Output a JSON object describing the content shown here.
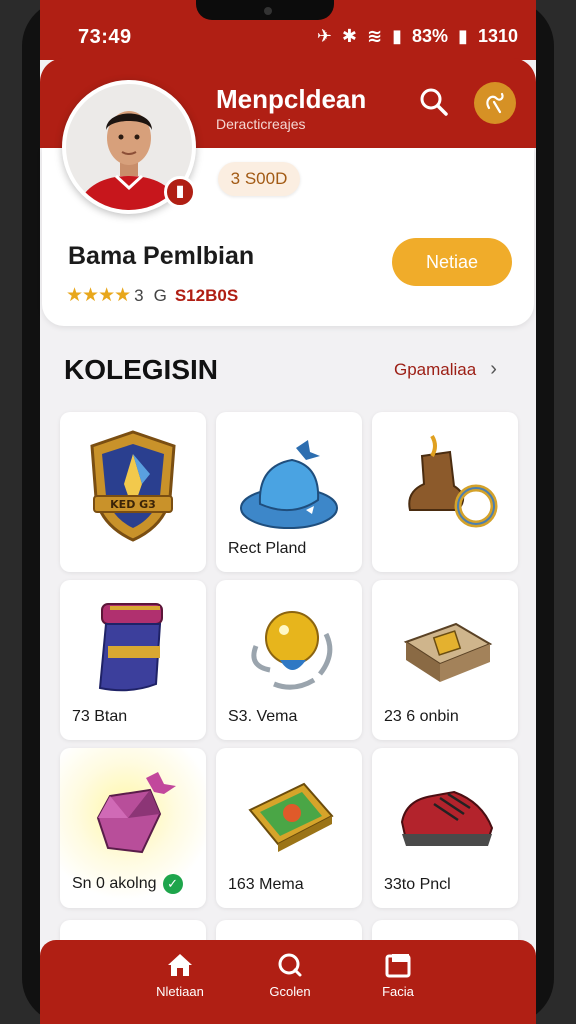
{
  "status_bar": {
    "time": "73:49",
    "battery": "83%",
    "clock_right": "1310"
  },
  "header": {
    "title": "Menpcldean",
    "subtitle": "Deracticreajes"
  },
  "profile": {
    "points": "3 S00D",
    "name": "Bama Pemlbian",
    "rating_count": "3",
    "rating_prefix": "G",
    "rating_id": "S12B0S",
    "action_label": "Netiae",
    "stars": 4
  },
  "section": {
    "title": "KOLEGISIN",
    "link": "Gpamaliaa"
  },
  "items": [
    {
      "label": "",
      "icon": "shield-icon"
    },
    {
      "label": "Rect Pland",
      "icon": "hat-icon"
    },
    {
      "label": "",
      "icon": "ring-boot-icon"
    },
    {
      "label": "73 Btan",
      "icon": "scroll-icon"
    },
    {
      "label": "S3. Vema",
      "icon": "medallion-icon"
    },
    {
      "label": "23 6 onbin",
      "icon": "book-icon"
    },
    {
      "label": "Sn 0 akolng",
      "icon": "gem-bag-icon",
      "checked": true
    },
    {
      "label": "163 Mema",
      "icon": "card-icon"
    },
    {
      "label": "33to Pncl",
      "icon": "shoe-icon"
    }
  ],
  "nav": [
    {
      "label": "Nletiaan",
      "icon": "home-icon"
    },
    {
      "label": "Gcolen",
      "icon": "search-icon"
    },
    {
      "label": "Facia",
      "icon": "gallery-icon"
    }
  ],
  "colors": {
    "brand": "#b01f14",
    "accent": "#f0ac2a",
    "check": "#1ea54b"
  }
}
